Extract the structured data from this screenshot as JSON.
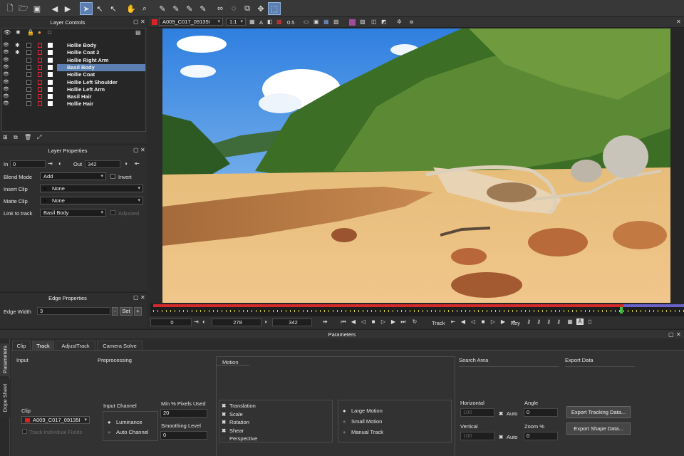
{
  "toolbar": {
    "icons": [
      "new-file-icon",
      "open-folder-icon",
      "save-icon",
      "undo-icon",
      "redo-icon",
      "select-arrow-icon",
      "select-b-icon",
      "select-plus-icon",
      "hand-icon",
      "zoom-icon",
      "pen-x-icon",
      "pen-xplus-icon",
      "pen-b-icon",
      "pen-bplus-icon",
      "link-icon",
      "lasso-icon",
      "transform-icon",
      "move-icon",
      "bounding-box-icon"
    ]
  },
  "viewer_bar": {
    "clip_name": "A009_C017_09135I",
    "zoom": "1:1",
    "opacity": "0.5"
  },
  "layer_controls": {
    "title": "Layer Controls",
    "layers": [
      {
        "name": "Hollie Body",
        "selected": false
      },
      {
        "name": "Hollie Coat 2",
        "selected": false
      },
      {
        "name": "Hollie Right Arm",
        "selected": false
      },
      {
        "name": "Basil Body",
        "selected": true
      },
      {
        "name": "Hollie Coat",
        "selected": false
      },
      {
        "name": "Hollie Left Shoulder",
        "selected": false
      },
      {
        "name": "Hollie Left Arm",
        "selected": false
      },
      {
        "name": "Basil Hair",
        "selected": false
      },
      {
        "name": "Hollie Hair",
        "selected": false
      }
    ]
  },
  "layer_properties": {
    "title": "Layer Properties",
    "in_label": "In",
    "in_value": "0",
    "out_label": "Out",
    "out_value": "342",
    "blend_mode_label": "Blend Mode",
    "blend_mode_value": "Add",
    "invert_label": "Invert",
    "insert_clip_label": "Insert Clip",
    "insert_clip_value": "None",
    "matte_clip_label": "Matte Clip",
    "matte_clip_value": "None",
    "link_to_track_label": "Link to track",
    "link_to_track_value": "Basil Body",
    "adjusted_label": "Adjusted"
  },
  "edge_properties": {
    "title": "Edge Properties",
    "edge_width_label": "Edge Width",
    "edge_width_value": "3",
    "minus": "-",
    "set": "Set",
    "plus": "+"
  },
  "timeline": {
    "start": "0",
    "current": "278",
    "end": "342",
    "track_label": "Track",
    "key_label": "Key"
  },
  "parameters": {
    "title": "Parameters",
    "side_tabs": [
      "Parameters",
      "Dope Sheet"
    ],
    "tabs": [
      "Clip",
      "Track",
      "AdjustTrack",
      "Camera Solve"
    ],
    "active_tab": "Track",
    "input_heading": "Input",
    "preprocessing_heading": "Preprocessing",
    "motion_heading": "Motion",
    "search_area_heading": "Search Area",
    "export_data_heading": "Export Data",
    "clip_label": "Clip",
    "clip_value": "A009_C017_09135I",
    "track_individual_fields": "Track Individual Fields",
    "input_channel_label": "Input Channel",
    "channel_luminance": "Luminance",
    "channel_auto": "Auto Channel",
    "min_pixels_label": "Min % Pixels Used",
    "min_pixels_value": "20",
    "smoothing_label": "Smoothing Level",
    "smoothing_value": "0",
    "motion_types": [
      "Translation",
      "Scale",
      "Rotation",
      "Shear",
      "Perspective"
    ],
    "motion_size": [
      "Large Motion",
      "Small Motion",
      "Manual Track"
    ],
    "horizontal_label": "Horizontal",
    "horizontal_value": "100",
    "vertical_label": "Vertical",
    "vertical_value": "100",
    "auto_label": "Auto",
    "angle_label": "Angle",
    "angle_value": "0",
    "zoom_label": "Zoom %",
    "zoom_value": "0",
    "export_tracking_button": "Export Tracking Data...",
    "export_shape_button": "Export Shape Data..."
  },
  "colors": {
    "accent": "#5b7fb0",
    "timeline_red": "#d22a2a",
    "timeline_blue": "#6a62c8",
    "timeline_yellow": "#d8d23a"
  }
}
